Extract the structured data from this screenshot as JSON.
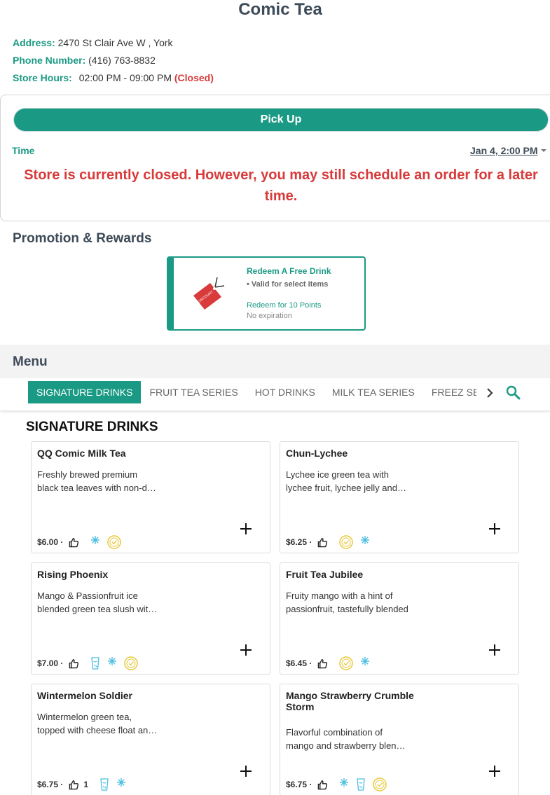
{
  "store": {
    "name": "Comic Tea",
    "address_label": "Address:",
    "address": "2470 St Clair Ave W , York",
    "phone_label": "Phone Number:",
    "phone": "(416) 763-8832",
    "hours_label": "Store Hours:",
    "hours": "02:00 PM - 09:00 PM",
    "status": "(Closed)"
  },
  "order": {
    "mode_button": "Pick Up",
    "time_label": "Time",
    "time_value": "Jan 4, 2:00 PM",
    "closed_message": "Store is currently closed. However, you may still schedule an order for a later time."
  },
  "promotion": {
    "heading": "Promotion & Rewards",
    "tag_text": "DISCOUNT",
    "card": {
      "title": "Redeem A Free Drink",
      "detail": "• Valid for select items",
      "redeem": "Redeem for 10 Points",
      "expiration": "No expiration"
    }
  },
  "menu": {
    "heading": "Menu",
    "categories": [
      "SIGNATURE DRINKS",
      "FRUIT TEA SERIES",
      "HOT DRINKS",
      "MILK TEA SERIES",
      "FREEZ SERIES"
    ],
    "active_category": "SIGNATURE DRINKS",
    "section_heading": "SIGNATURE DRINKS",
    "items": [
      {
        "name": "QQ Comic Milk Tea",
        "desc": "Freshly brewed premium black tea leaves with non-dairy creamer",
        "price": "$6.00 ·",
        "likes": "",
        "icons": [
          "ice-icon",
          "popular-icon"
        ]
      },
      {
        "name": "Chun-Lychee",
        "desc": "Lychee ice green tea with lychee fruit, lychee jelly and more",
        "price": "$6.25 ·",
        "likes": "",
        "icons": [
          "popular-icon",
          "ice-icon"
        ]
      },
      {
        "name": "Rising Phoenix",
        "desc": "Mango & Passionfruit ice blended green tea slush with toppings",
        "price": "$7.00 ·",
        "likes": "",
        "icons": [
          "cup-icon",
          "ice-icon",
          "popular-icon"
        ]
      },
      {
        "name": "Fruit Tea Jubilee",
        "desc": "Fruity mango with a hint of passionfruit, tastefully blended",
        "price": "$6.45 ·",
        "likes": "",
        "icons": [
          "popular-icon",
          "ice-icon"
        ]
      },
      {
        "name": "Wintermelon Soldier",
        "desc": "Wintermelon green tea, topped with cheese float and more",
        "price": "$6.75 ·",
        "likes": "1",
        "icons": [
          "cup-icon",
          "ice-icon"
        ]
      },
      {
        "name": "Mango Strawberry Crumble Storm",
        "desc": "Flavorful combination of mango and strawberry blended",
        "price": "$6.75 ·",
        "likes": "",
        "icons": [
          "ice-icon",
          "cup-icon",
          "popular-icon"
        ]
      }
    ]
  },
  "colors": {
    "accent": "#1a9a84",
    "closed": "#d83a3a",
    "heading": "#3d4a57",
    "icon": "#4fbfe0",
    "badge": "#e8c93a",
    "tag": "#d93a3a"
  }
}
